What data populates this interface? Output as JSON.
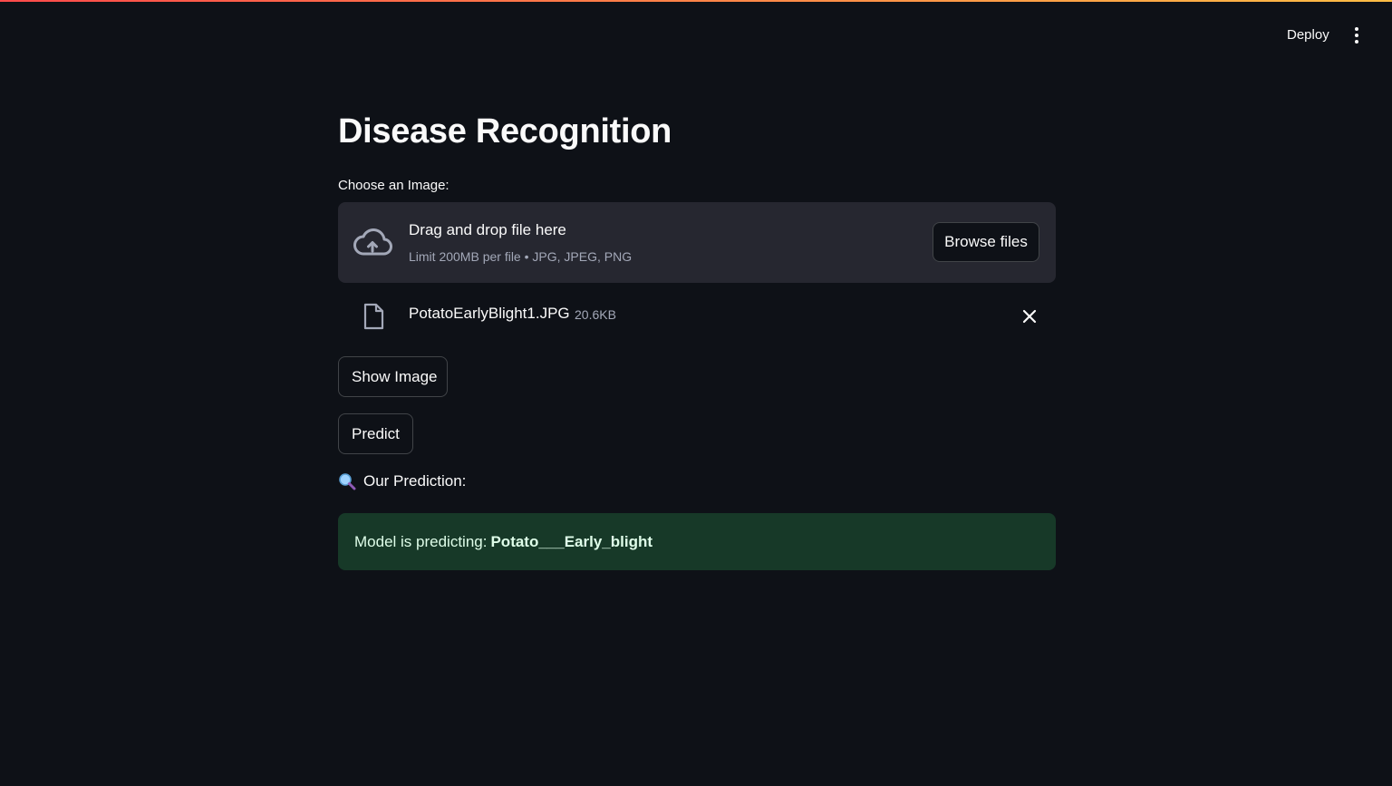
{
  "header": {
    "deploy_label": "Deploy",
    "menu_icon": "vertical-dots-icon"
  },
  "main": {
    "title": "Disease Recognition",
    "uploader": {
      "label": "Choose an Image:",
      "drop_title": "Drag and drop file here",
      "drop_limit": "Limit 200MB per file • JPG, JPEG, PNG",
      "browse_label": "Browse files",
      "icon": "cloud-upload-icon"
    },
    "uploaded_file": {
      "name": "PotatoEarlyBlight1.JPG",
      "size": "20.6KB",
      "icon": "file-icon",
      "remove_icon": "close-icon"
    },
    "buttons": {
      "show_image": "Show Image",
      "predict": "Predict"
    },
    "prediction": {
      "heading": "Our Prediction:",
      "icon": "magnifier-icon",
      "message_prefix": "Model is predicting:",
      "result": "Potato___Early_blight"
    }
  },
  "colors": {
    "background": "#0e1117",
    "card": "#262730",
    "success_bg": "#173928",
    "success_text": "#dffde9",
    "accent_top": "#ff4b4b"
  }
}
